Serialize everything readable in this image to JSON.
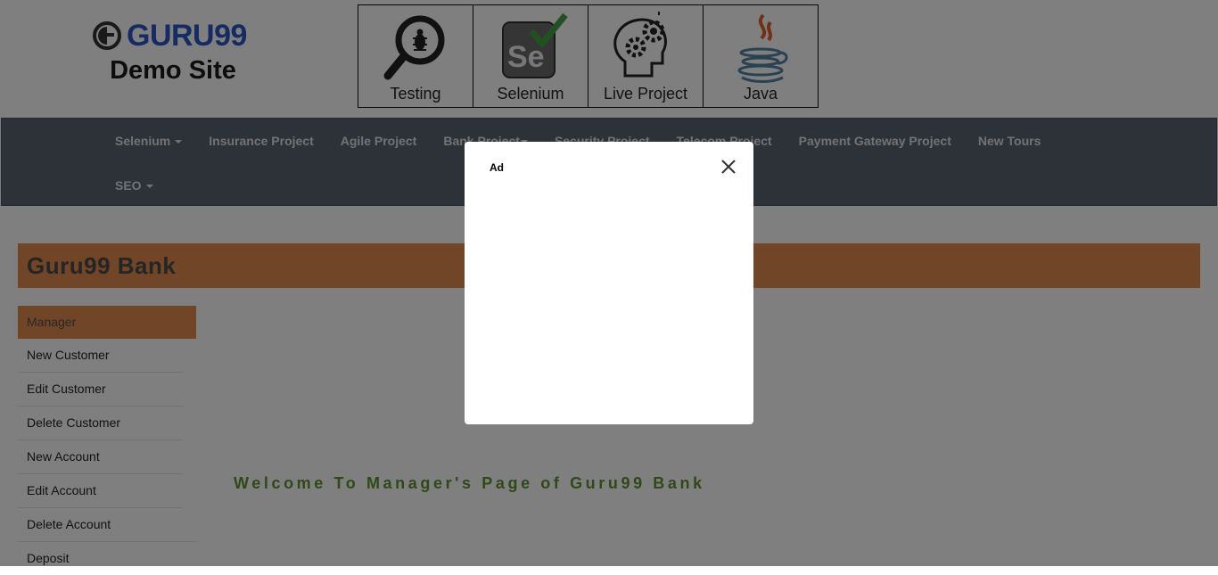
{
  "header": {
    "brand": "GURU99",
    "subtitle": "Demo Site",
    "tiles": [
      {
        "label": "Testing",
        "icon": "magnifier-bug-icon"
      },
      {
        "label": "Selenium",
        "icon": "selenium-check-icon"
      },
      {
        "label": "Live Project",
        "icon": "head-gears-icon"
      },
      {
        "label": "Java",
        "icon": "java-cup-icon"
      }
    ]
  },
  "nav": {
    "row1": [
      "Selenium",
      "Insurance Project",
      "Agile Project",
      "Bank Project",
      "Security Project",
      "Telecom Project",
      "Payment Gateway Project",
      "New Tours"
    ],
    "row2": [
      "SEO"
    ]
  },
  "bank": {
    "title": "Guru99 Bank"
  },
  "sidebar": {
    "header": "Manager",
    "items": [
      "New Customer",
      "Edit Customer",
      "Delete Customer",
      "New Account",
      "Edit Account",
      "Delete Account",
      "Deposit"
    ]
  },
  "main": {
    "welcome": "Welcome To Manager's Page of Guru99 Bank"
  },
  "dialog": {
    "label": "Ad",
    "close_icon": "close-icon"
  },
  "colors": {
    "brand_blue": "#2c56c7",
    "nav_bg": "#5b6370",
    "bank_orange": "#e38a50",
    "welcome_green": "#5f9231"
  }
}
